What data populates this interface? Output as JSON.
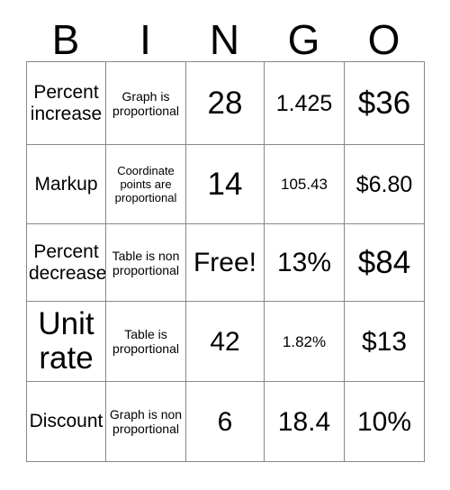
{
  "card": {
    "title": "BINGO",
    "header_letters": [
      "B",
      "I",
      "N",
      "G",
      "O"
    ],
    "free_space_label": "Free!",
    "columns": [
      {
        "letter": "B",
        "name": "column-b"
      },
      {
        "letter": "I",
        "name": "column-i"
      },
      {
        "letter": "N",
        "name": "column-n"
      },
      {
        "letter": "G",
        "name": "column-g"
      },
      {
        "letter": "O",
        "name": "column-o"
      }
    ],
    "rows": [
      {
        "cells": [
          {
            "text": "Percent increase",
            "size": "t-sm",
            "free": false
          },
          {
            "text": "Graph is proportional",
            "size": "t-tiny",
            "free": false
          },
          {
            "text": "28",
            "size": "t-xl",
            "free": false
          },
          {
            "text": "1.425",
            "size": "t-md",
            "free": false
          },
          {
            "text": "$36",
            "size": "t-xl",
            "free": false
          }
        ]
      },
      {
        "cells": [
          {
            "text": "Markup",
            "size": "t-sm",
            "free": false
          },
          {
            "text": "Coordinate points are proportional",
            "size": "t-mini",
            "free": false
          },
          {
            "text": "14",
            "size": "t-xl",
            "free": false
          },
          {
            "text": "105.43",
            "size": "t-xs",
            "free": false
          },
          {
            "text": "$6.80",
            "size": "t-md",
            "free": false
          }
        ]
      },
      {
        "cells": [
          {
            "text": "Percent decrease",
            "size": "t-sm",
            "free": false
          },
          {
            "text": "Table is non proportional",
            "size": "t-tiny",
            "free": false
          },
          {
            "text": "Free!",
            "size": "t-lg",
            "free": true
          },
          {
            "text": "13%",
            "size": "t-lg",
            "free": false
          },
          {
            "text": "$84",
            "size": "t-xl",
            "free": false
          }
        ]
      },
      {
        "cells": [
          {
            "text": "Unit rate",
            "size": "t-xl",
            "free": false
          },
          {
            "text": "Table is proportional",
            "size": "t-tiny",
            "free": false
          },
          {
            "text": "42",
            "size": "t-lg",
            "free": false
          },
          {
            "text": "1.82%",
            "size": "t-xs",
            "free": false
          },
          {
            "text": "$13",
            "size": "t-lg",
            "free": false
          }
        ]
      },
      {
        "cells": [
          {
            "text": "Discount",
            "size": "t-sm",
            "free": false
          },
          {
            "text": "Graph is non proportional",
            "size": "t-tiny",
            "free": false
          },
          {
            "text": "6",
            "size": "t-lg",
            "free": false
          },
          {
            "text": "18.4",
            "size": "t-lg",
            "free": false
          },
          {
            "text": "10%",
            "size": "t-lg",
            "free": false
          }
        ]
      }
    ]
  },
  "colors": {
    "background": "#ffffff",
    "text": "#000000",
    "grid_line": "#888888"
  }
}
